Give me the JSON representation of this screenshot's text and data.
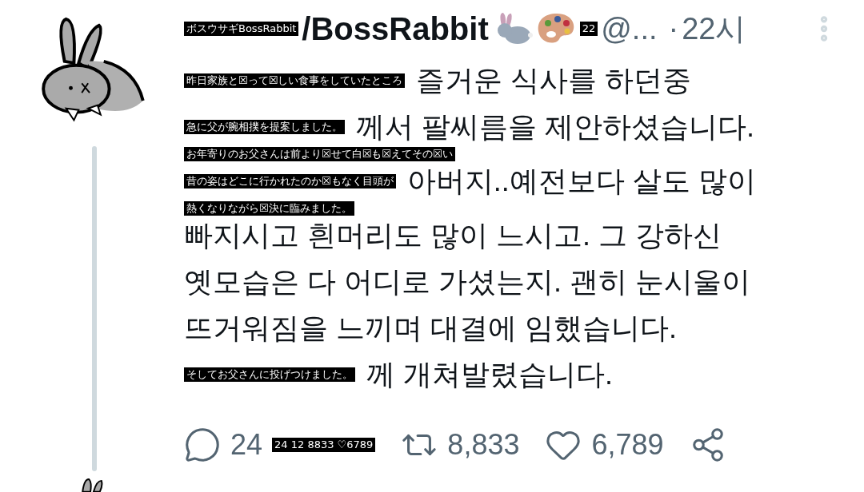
{
  "author": {
    "translation": "ボスウサギBossRabbit",
    "name": "/BossRabbit",
    "handle_translation": "22",
    "handle": "@...",
    "separator": "·",
    "time": "22시"
  },
  "body": [
    {
      "kind": "line",
      "translation": "昨日家族と☒って☒しい食事をしていたところ",
      "text": "즐거운 식사를 하던중"
    },
    {
      "kind": "line",
      "translation": "急に父が腕相撲を提案しました。",
      "text": "께서 팔씨름을 제안하셨습니다."
    },
    {
      "kind": "translation",
      "text": "お年寄りのお父さんは前より☒せて白☒も☒えてその☒い"
    },
    {
      "kind": "line",
      "translation": "昔の姿はどこに行かれたのか☒もなく目頭が",
      "text": "아버지..예전보다 살도 많이"
    },
    {
      "kind": "translation",
      "text": "熱くなりながら☒決に臨みました。"
    },
    {
      "kind": "line",
      "text": "빠지시고 흰머리도 많이 느시고. 그 강하신"
    },
    {
      "kind": "line",
      "text": "옛모습은 다 어디로 가셨는지. 괜히 눈시울이"
    },
    {
      "kind": "line",
      "text": "뜨거워짐을 느끼며 대결에 임했습니다."
    },
    {
      "kind": "line",
      "translation": "そしてお父さんに投げつけました。",
      "text": "께 개쳐발렸습니다."
    }
  ],
  "actions": {
    "translation": "24 12 8833 ♡6789",
    "items": [
      {
        "kind": "reply",
        "count": "24"
      },
      {
        "kind": "retweet",
        "count": "8,833"
      },
      {
        "kind": "like",
        "count": "6,789"
      },
      {
        "kind": "share"
      }
    ]
  }
}
